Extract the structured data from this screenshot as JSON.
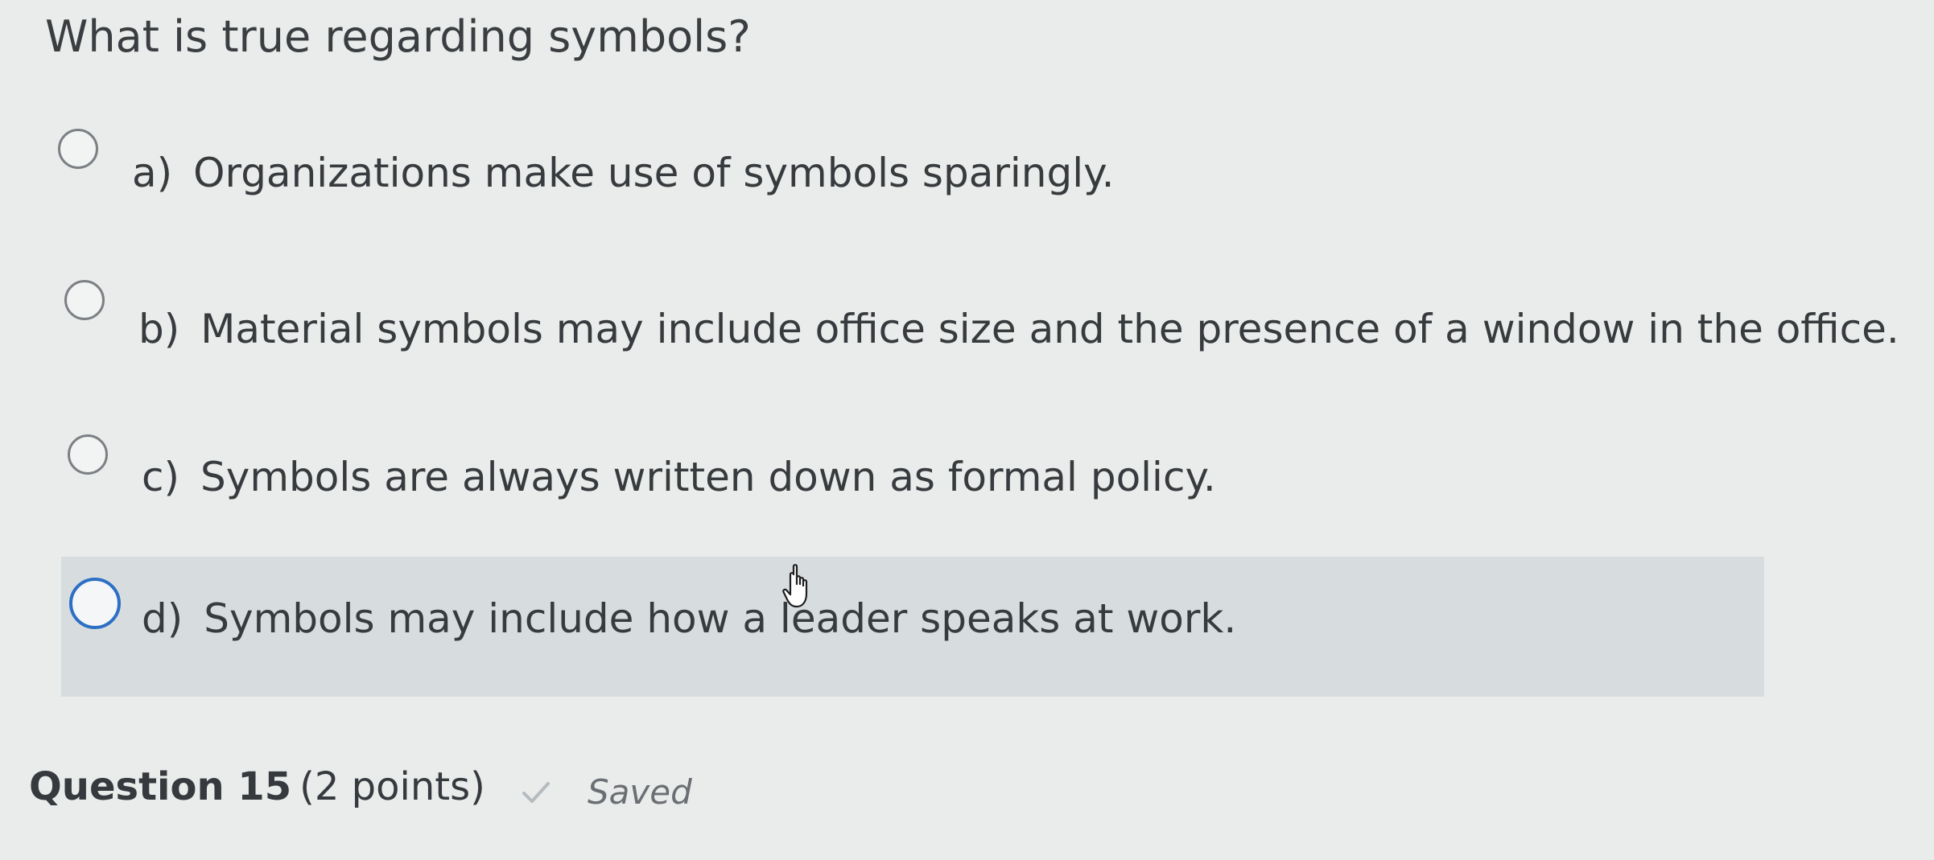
{
  "question": {
    "text": "What is true regarding symbols?"
  },
  "choices": [
    {
      "letter": "a)",
      "text": "Organizations make use of symbols sparingly."
    },
    {
      "letter": "b)",
      "text": "Material symbols may include office size and the presence of a window in the office."
    },
    {
      "letter": "c)",
      "text": "Symbols are always written down as formal policy."
    },
    {
      "letter": "d)",
      "text": "Symbols may include how a leader speaks at work."
    }
  ],
  "footer": {
    "question_number": "Question 15",
    "points": "(2 points)",
    "status": "Saved"
  },
  "icons": {
    "cursor": "hand-pointer-icon",
    "status": "check-icon"
  },
  "colors": {
    "hover_background": "#d7dcdf",
    "radio_focus_border": "#2c6fc4"
  }
}
